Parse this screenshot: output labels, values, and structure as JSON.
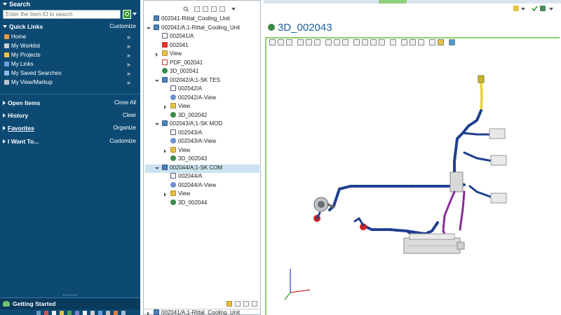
{
  "search": {
    "title": "Search",
    "placeholder": "Enter the Item ID to search"
  },
  "quick_links": {
    "title": "Quick Links",
    "action": "Customize",
    "items": [
      {
        "label": "Home",
        "icon": "home-icon",
        "color": "#e89a3a"
      },
      {
        "label": "My Worklist",
        "icon": "worklist-icon",
        "color": "#d0d0d0"
      },
      {
        "label": "My Projects",
        "icon": "projects-icon",
        "color": "#f0c040"
      },
      {
        "label": "My Links",
        "icon": "links-icon",
        "color": "#6aa0e0"
      },
      {
        "label": "My Saved Searches",
        "icon": "saved-search-icon",
        "color": "#8fb8e8"
      },
      {
        "label": "My View/Markup",
        "icon": "markup-icon",
        "color": "#c0c0c0"
      }
    ]
  },
  "sections": [
    {
      "title": "Open Items",
      "action": "Close All"
    },
    {
      "title": "History",
      "action": "Clear"
    },
    {
      "title": "Favorites",
      "action": "Organize"
    },
    {
      "title": "I Want To...",
      "action": "Customize"
    }
  ],
  "getting_started": "Getting Started",
  "tree": [
    {
      "label": "002041-Rittal_Cooling_Unit",
      "icon": "part",
      "level": 0,
      "toggle": "none"
    },
    {
      "label": "002041/A;1-Rittal_Cooling_Unit",
      "icon": "part",
      "level": 0,
      "toggle": "down"
    },
    {
      "label": "002041/A",
      "icon": "doc",
      "level": 1,
      "toggle": "none"
    },
    {
      "label": "002041",
      "icon": "doc-red",
      "level": 1,
      "toggle": "none"
    },
    {
      "label": "View",
      "icon": "folder",
      "level": 1,
      "toggle": "right"
    },
    {
      "label": "PDF_002041",
      "icon": "pdf",
      "level": 1,
      "toggle": "none"
    },
    {
      "label": "3D_002041",
      "icon": "model",
      "level": 1,
      "toggle": "none"
    },
    {
      "label": "002042/A;1-SK TES",
      "icon": "part",
      "level": 1,
      "toggle": "down"
    },
    {
      "label": "002042/A",
      "icon": "doc",
      "level": 2,
      "toggle": "none"
    },
    {
      "label": "002042/A-View",
      "icon": "link",
      "level": 2,
      "toggle": "none"
    },
    {
      "label": "View",
      "icon": "folder",
      "level": 2,
      "toggle": "right"
    },
    {
      "label": "3D_002042",
      "icon": "model",
      "level": 2,
      "toggle": "none"
    },
    {
      "label": "002043/A;1-SK MOD",
      "icon": "part",
      "level": 1,
      "toggle": "down"
    },
    {
      "label": "002043/A",
      "icon": "doc",
      "level": 2,
      "toggle": "none"
    },
    {
      "label": "002043/A-View",
      "icon": "link",
      "level": 2,
      "toggle": "none"
    },
    {
      "label": "View",
      "icon": "folder",
      "level": 2,
      "toggle": "right"
    },
    {
      "label": "3D_002043",
      "icon": "model",
      "level": 2,
      "toggle": "none",
      "selected": true
    },
    {
      "label": "002044/A;1-SK COM",
      "icon": "part",
      "level": 1,
      "toggle": "down"
    },
    {
      "label": "002044/A",
      "icon": "doc",
      "level": 2,
      "toggle": "none"
    },
    {
      "label": "002044/A-View",
      "icon": "link",
      "level": 2,
      "toggle": "none"
    },
    {
      "label": "View",
      "icon": "folder",
      "level": 2,
      "toggle": "right"
    },
    {
      "label": "3D_002044",
      "icon": "model",
      "level": 2,
      "toggle": "none"
    }
  ],
  "tree_bottom_item": "002041/A;1-Rittal_Cooling_Unit",
  "viewer": {
    "title": "3D_002043",
    "title_icon": "model-icon"
  },
  "colors": {
    "nav_bg": "#0d4a73",
    "accent_green": "#8fcf6f",
    "title_blue": "#1b5ea0",
    "cable_blue": "#1f3f8f",
    "cable_purple": "#8a2a9a",
    "cable_yellow": "#e8d84a"
  }
}
